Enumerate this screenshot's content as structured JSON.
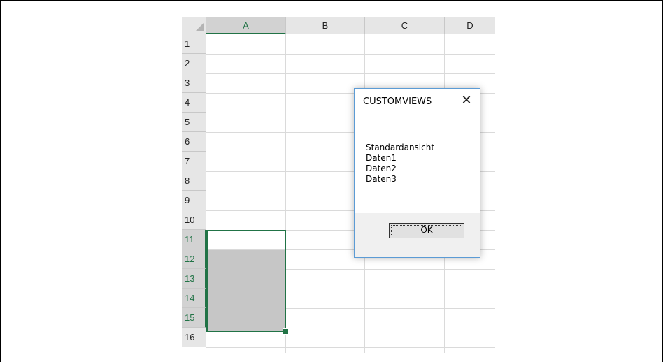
{
  "spreadsheet": {
    "columns": [
      "A",
      "B",
      "C",
      "D"
    ],
    "rows": [
      "1",
      "2",
      "3",
      "4",
      "5",
      "6",
      "7",
      "8",
      "9",
      "10",
      "11",
      "12",
      "13",
      "14",
      "15",
      "16"
    ],
    "selected_column": "A",
    "selected_rows": [
      "11",
      "12",
      "13",
      "14",
      "15"
    ],
    "accent_color": "#217346"
  },
  "dialog": {
    "title": "CUSTOMVIEWS",
    "close_glyph": "✕",
    "message_lines": [
      "Standardansicht",
      "Daten1",
      "Daten2",
      "Daten3"
    ],
    "ok_label": "OK"
  }
}
